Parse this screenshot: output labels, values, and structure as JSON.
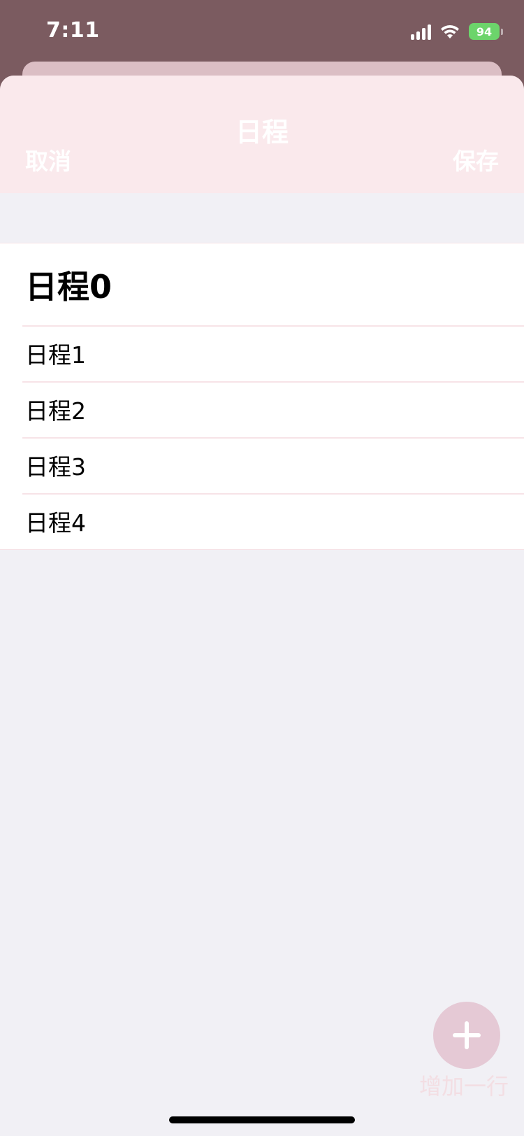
{
  "status_bar": {
    "time": "7:11",
    "battery": "94"
  },
  "nav": {
    "title": "日程",
    "cancel_label": "取消",
    "save_label": "保存"
  },
  "list": {
    "items": [
      {
        "label": "日程0"
      },
      {
        "label": "日程1"
      },
      {
        "label": "日程2"
      },
      {
        "label": "日程3"
      },
      {
        "label": "日程4"
      }
    ]
  },
  "fab": {
    "label": "增加一行",
    "icon": "plus-icon"
  },
  "colors": {
    "header_bg": "#fae9ec",
    "status_bg": "#7b5b60",
    "sheet_bg": "#f1f0f5",
    "fab_bg": "#e5c9d5",
    "battery": "#6cd46b"
  }
}
